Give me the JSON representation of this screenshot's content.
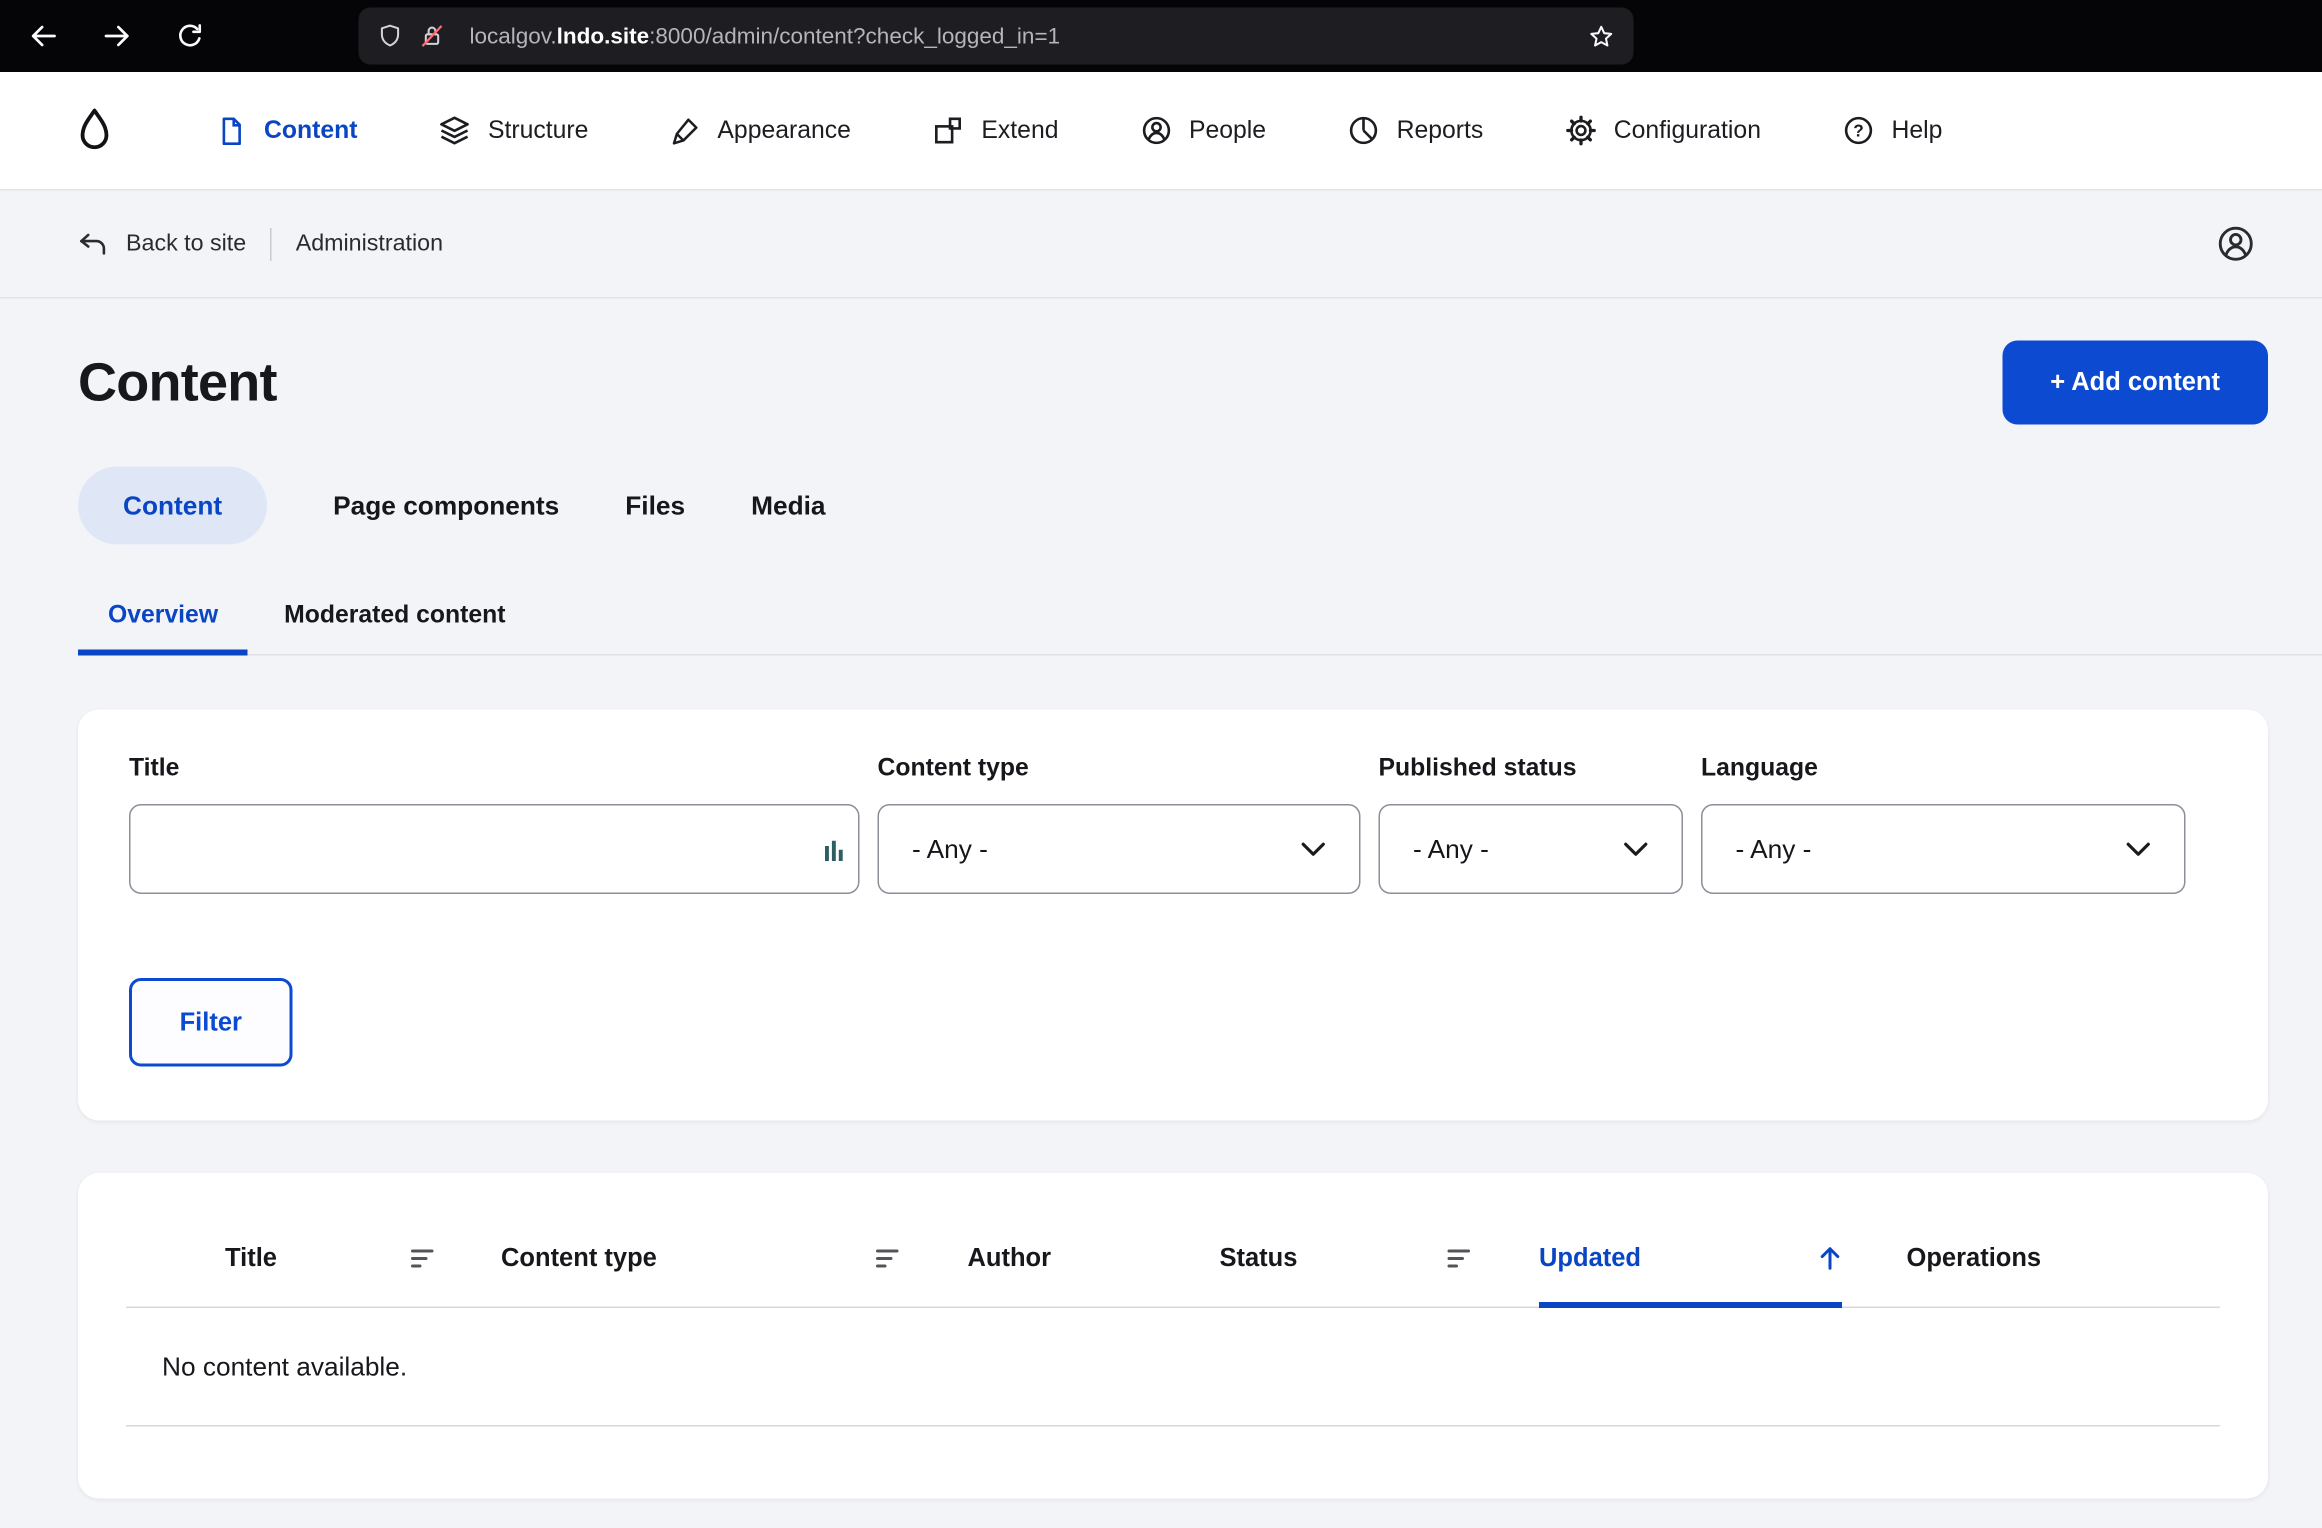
{
  "browser": {
    "url": {
      "subdomain": "localgov.",
      "domain": "lndo.site",
      "rest": ":8000/admin/content?check_logged_in=1"
    }
  },
  "toolbar": {
    "items": [
      {
        "label": "Content"
      },
      {
        "label": "Structure"
      },
      {
        "label": "Appearance"
      },
      {
        "label": "Extend"
      },
      {
        "label": "People"
      },
      {
        "label": "Reports"
      },
      {
        "label": "Configuration"
      },
      {
        "label": "Help"
      }
    ]
  },
  "breadcrumb": {
    "back_to_site": "Back to site",
    "administration": "Administration"
  },
  "page": {
    "title": "Content",
    "add_button": "+ Add content"
  },
  "tabs": {
    "primary": [
      {
        "label": "Content",
        "active": true
      },
      {
        "label": "Page components",
        "active": false
      },
      {
        "label": "Files",
        "active": false
      },
      {
        "label": "Media",
        "active": false
      }
    ],
    "secondary": [
      {
        "label": "Overview",
        "active": true
      },
      {
        "label": "Moderated content",
        "active": false
      }
    ]
  },
  "filter": {
    "title_label": "Title",
    "title_value": "",
    "content_type_label": "Content type",
    "published_status_label": "Published status",
    "language_label": "Language",
    "any": "- Any -",
    "submit": "Filter"
  },
  "table": {
    "headers": [
      "Title",
      "Content type",
      "Author",
      "Status",
      "Updated",
      "Operations"
    ],
    "sort_column": "Updated",
    "sort_direction": "asc",
    "empty": "No content available."
  },
  "colors": {
    "primary_button": "#0b4ad1",
    "active_link": "#0a46c4",
    "page_background": "#f3f4f8",
    "tab_pill_background": "#dfe7f7",
    "insecure_slash": "#ff6a75"
  }
}
